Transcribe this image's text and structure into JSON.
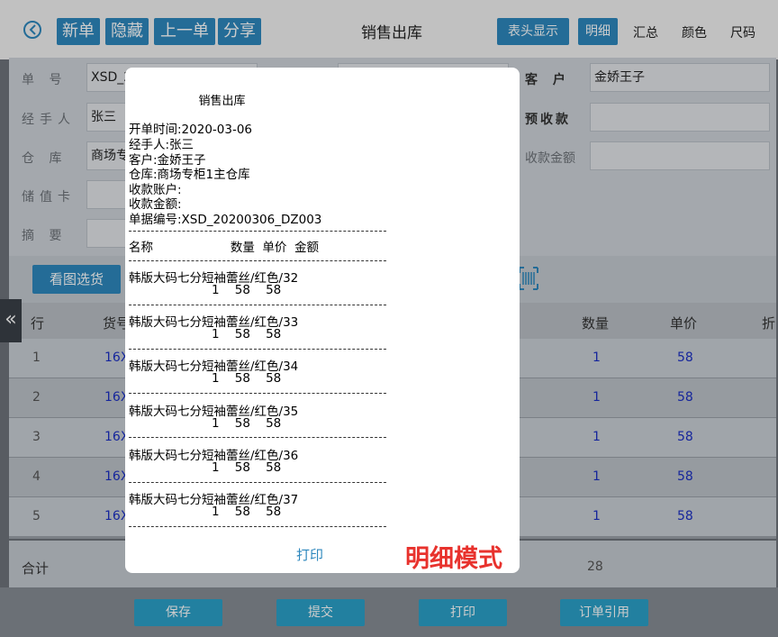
{
  "topbar": {
    "buttons": [
      "新单",
      "隐藏",
      "上一单",
      "分享"
    ],
    "title": "销售出库",
    "right": {
      "header_display": "表头显示",
      "detail": "明细",
      "summary": "汇总",
      "color": "颜色",
      "size": "尺码"
    }
  },
  "form": {
    "order_no": {
      "label": "单 号",
      "value": "XSD_2"
    },
    "handler": {
      "label": "经手人",
      "value": "张三"
    },
    "warehouse": {
      "label": "仓 库",
      "value": "商场专"
    },
    "stored_card": {
      "label": "储值卡",
      "value": ""
    },
    "memo": {
      "label": "摘 要",
      "value": ""
    },
    "customer": {
      "label": "客 户",
      "value": "金娇王子"
    },
    "prepay": {
      "label": "预收款",
      "value": ""
    },
    "receipt_amount": {
      "label": "收款金额",
      "value": ""
    }
  },
  "toolbar": {
    "browse_label": "看图选货"
  },
  "table": {
    "headers": {
      "row": "行",
      "sku": "货号",
      "qty": "数量",
      "price": "单价",
      "extra": "折"
    },
    "rows": [
      {
        "n": "1",
        "sku": "16X",
        "qty": "1",
        "price": "58"
      },
      {
        "n": "2",
        "sku": "16X",
        "qty": "1",
        "price": "58"
      },
      {
        "n": "3",
        "sku": "16X",
        "qty": "1",
        "price": "58"
      },
      {
        "n": "4",
        "sku": "16X",
        "qty": "1",
        "price": "58"
      },
      {
        "n": "5",
        "sku": "16X",
        "qty": "1",
        "price": "58"
      }
    ],
    "total_label": "合计",
    "total_qty": "28"
  },
  "bottom": {
    "save": "保存",
    "submit": "提交",
    "print": "打印",
    "order_ref": "订单引用"
  },
  "sidetab": "«",
  "dialog": {
    "title": "销售出库",
    "info": [
      "开单时间:2020-03-06",
      "经手人:张三",
      "客户:金娇王子",
      "仓库:商场专柜1主仓库",
      "收款账户:",
      "收款金额:",
      "单据编号:XSD_20200306_DZ003"
    ],
    "col_header": "名称                    数量  单价  金额",
    "items": [
      {
        "name": "韩版大码七分短袖蕾丝/红色/32",
        "nums": "1    58    58"
      },
      {
        "name": "韩版大码七分短袖蕾丝/红色/33",
        "nums": "1    58    58"
      },
      {
        "name": "韩版大码七分短袖蕾丝/红色/34",
        "nums": "1    58    58"
      },
      {
        "name": "韩版大码七分短袖蕾丝/红色/35",
        "nums": "1    58    58"
      },
      {
        "name": "韩版大码七分短袖蕾丝/红色/36",
        "nums": "1    58    58"
      },
      {
        "name": "韩版大码七分短袖蕾丝/红色/37",
        "nums": "1    58    58"
      }
    ],
    "print_label": "打印"
  },
  "mode_label": "明细模式"
}
